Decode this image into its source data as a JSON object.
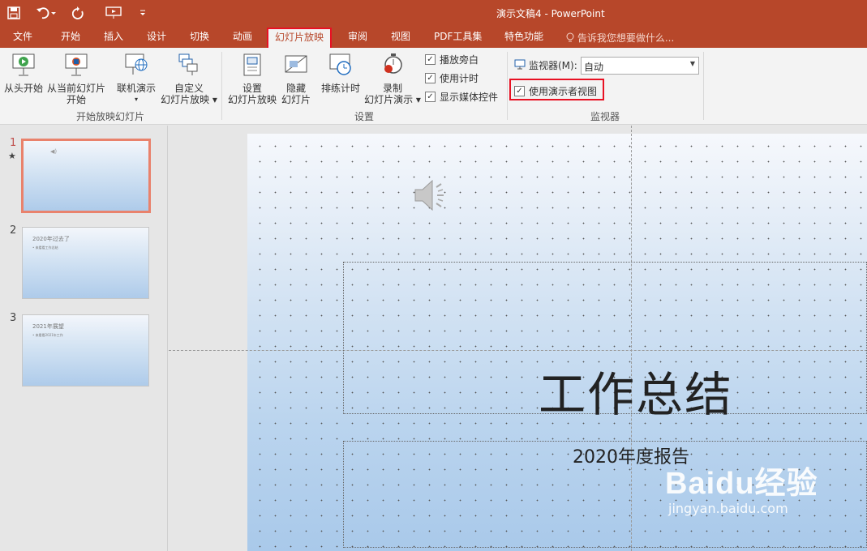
{
  "window": {
    "title": "演示文稿4 - PowerPoint"
  },
  "tabs": [
    {
      "label": "文件"
    },
    {
      "label": "开始"
    },
    {
      "label": "插入"
    },
    {
      "label": "设计"
    },
    {
      "label": "切换"
    },
    {
      "label": "动画"
    },
    {
      "label": "幻灯片放映"
    },
    {
      "label": "审阅"
    },
    {
      "label": "视图"
    },
    {
      "label": "PDF工具集"
    },
    {
      "label": "特色功能"
    }
  ],
  "tell_me": "告诉我您想要做什么...",
  "ribbon": {
    "start_group": {
      "label": "开始放映幻灯片",
      "from_beginning": "从头开始",
      "from_current_1": "从当前幻灯片",
      "from_current_2": "开始",
      "online_present": "联机演示",
      "custom_show_1": "自定义",
      "custom_show_2": "幻灯片放映 ▾"
    },
    "setup_group": {
      "label": "设置",
      "setup_show_1": "设置",
      "setup_show_2": "幻灯片放映",
      "hide_slide_1": "隐藏",
      "hide_slide_2": "幻灯片",
      "rehearse": "排练计时",
      "record_1": "录制",
      "record_2": "幻灯片演示 ▾",
      "chk_narration": "播放旁白",
      "chk_timings": "使用计时",
      "chk_media": "显示媒体控件"
    },
    "monitor_group": {
      "label": "监视器",
      "monitor_label": "监视器(M):",
      "monitor_value": "自动",
      "presenter_view": "使用演示者视图"
    }
  },
  "slides_pane": [
    {
      "number": "1",
      "star": "★",
      "title": "",
      "body": ""
    },
    {
      "number": "2",
      "title": "2020年过去了",
      "body": "• 来看看工作总结"
    },
    {
      "number": "3",
      "title": "2021年展望",
      "body": "• 来看看2021年工作"
    }
  ],
  "slide": {
    "title": "工作总结",
    "subtitle": "2020年度报告"
  },
  "watermark": {
    "logo": "Baidu经验",
    "url": "jingyan.baidu.com"
  },
  "colors": {
    "accent": "#b7472a",
    "highlight": "#e81123",
    "selected_thumb": "#e9826c"
  }
}
